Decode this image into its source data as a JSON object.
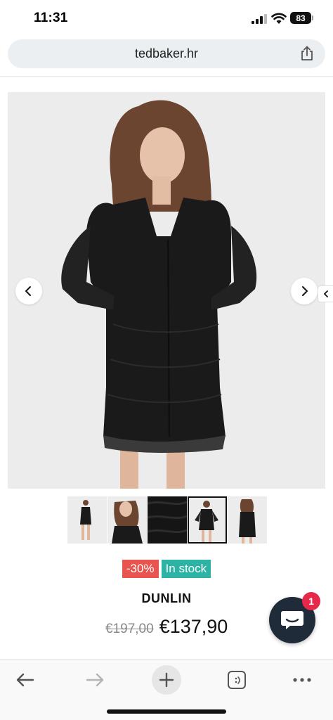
{
  "status": {
    "time": "11:31",
    "battery": "83"
  },
  "browser": {
    "url": "tedbaker.hr"
  },
  "product": {
    "discount_badge": "-30%",
    "stock_badge": "In stock",
    "title": "DUNLIN",
    "old_price": "€197,00",
    "new_price": "€137,90"
  },
  "chat": {
    "unread_count": "1"
  },
  "colors": {
    "accent_sale": "#e8544e",
    "accent_stock": "#2cb3a4",
    "chat_bg": "#1f2b38",
    "chat_badge": "#e5294b"
  },
  "icons": [
    "signal-icon",
    "wifi-icon",
    "battery-icon",
    "share-icon",
    "chevron-left-icon",
    "chevron-right-icon",
    "chat-icon",
    "back-arrow-icon",
    "forward-arrow-icon",
    "plus-icon",
    "tabs-icon",
    "more-icon"
  ]
}
